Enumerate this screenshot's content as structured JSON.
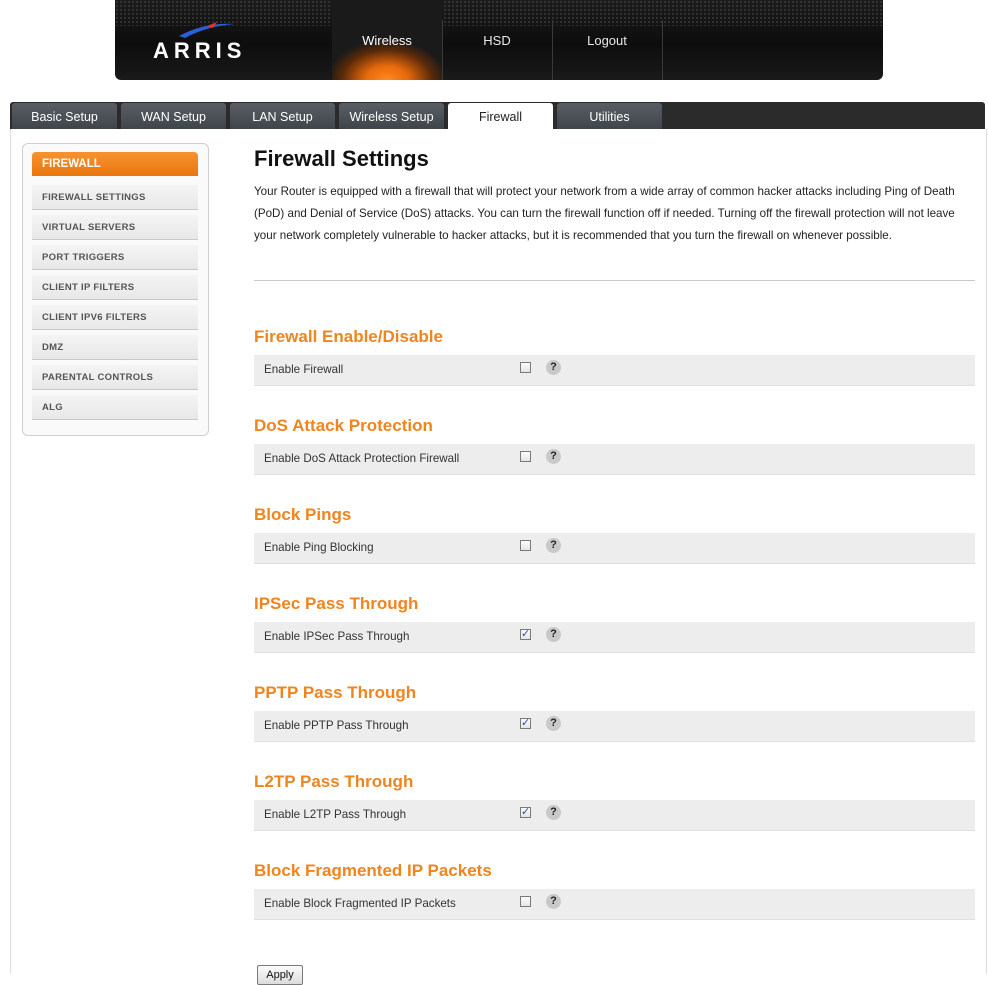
{
  "brand": {
    "logo_text": "ARRIS",
    "accent_color": "#f0841d"
  },
  "top_nav": [
    {
      "label": "Wireless",
      "active": true
    },
    {
      "label": "HSD",
      "active": false
    },
    {
      "label": "Logout",
      "active": false
    }
  ],
  "tabs": [
    {
      "label": "Basic Setup",
      "active": false
    },
    {
      "label": "WAN Setup",
      "active": false
    },
    {
      "label": "LAN Setup",
      "active": false
    },
    {
      "label": "Wireless Setup",
      "active": false
    },
    {
      "label": "Firewall",
      "active": true
    },
    {
      "label": "Utilities",
      "active": false
    }
  ],
  "sidebar": {
    "header": "FIREWALL",
    "items": [
      {
        "label": "FIREWALL SETTINGS"
      },
      {
        "label": "VIRTUAL SERVERS"
      },
      {
        "label": "PORT TRIGGERS"
      },
      {
        "label": "CLIENT IP FILTERS"
      },
      {
        "label": "CLIENT IPV6 FILTERS"
      },
      {
        "label": "DMZ"
      },
      {
        "label": "PARENTAL CONTROLS"
      },
      {
        "label": "ALG"
      }
    ]
  },
  "main": {
    "title": "Firewall Settings",
    "intro": "Your Router is equipped with a firewall that will protect your network from a wide array of common hacker attacks including Ping of Death (PoD) and Denial of Service (DoS) attacks. You can turn the firewall function off if needed. Turning off the firewall protection will not leave your network completely vulnerable to hacker attacks, but it is recommended that you turn the firewall on whenever possible.",
    "sections": [
      {
        "title": "Firewall Enable/Disable",
        "label": "Enable Firewall",
        "checked": false
      },
      {
        "title": "DoS Attack Protection",
        "label": "Enable DoS Attack Protection Firewall",
        "checked": false
      },
      {
        "title": "Block Pings",
        "label": "Enable Ping Blocking",
        "checked": false
      },
      {
        "title": "IPSec Pass Through",
        "label": "Enable IPSec Pass Through",
        "checked": true
      },
      {
        "title": "PPTP Pass Through",
        "label": "Enable PPTP Pass Through",
        "checked": true
      },
      {
        "title": "L2TP Pass Through",
        "label": "Enable L2TP Pass Through",
        "checked": true
      },
      {
        "title": "Block Fragmented IP Packets",
        "label": "Enable Block Fragmented IP Packets",
        "checked": false
      }
    ],
    "help_glyph": "?",
    "apply_label": "Apply"
  }
}
